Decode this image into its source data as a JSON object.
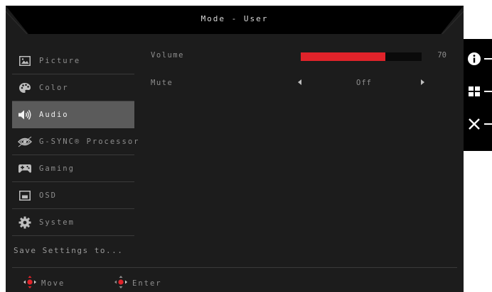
{
  "header": {
    "title": "Mode - User"
  },
  "menu": {
    "items": [
      {
        "label": "Picture",
        "icon": "picture-icon",
        "active": false
      },
      {
        "label": "Color",
        "icon": "palette-icon",
        "active": false
      },
      {
        "label": "Audio",
        "icon": "speaker-icon",
        "active": true
      },
      {
        "label": "G-SYNC® Processor",
        "icon": "gsync-eye-icon",
        "active": false
      },
      {
        "label": "Gaming",
        "icon": "gamepad-icon",
        "active": false
      },
      {
        "label": "OSD",
        "icon": "osd-icon",
        "active": false
      },
      {
        "label": "System",
        "icon": "gear-icon",
        "active": false
      }
    ],
    "save_label": "Save Settings to..."
  },
  "audio": {
    "volume": {
      "label": "Volume",
      "value": 70,
      "display": "70"
    },
    "mute": {
      "label": "Mute",
      "value": "Off"
    }
  },
  "footer": {
    "move_label": "Move",
    "enter_label": "Enter"
  },
  "side_buttons": [
    {
      "icon": "info-icon"
    },
    {
      "icon": "grid-icon"
    },
    {
      "icon": "close-icon"
    }
  ],
  "colors": {
    "accent": "#e0232a",
    "background": "#1c1c1c",
    "active_row": "#5b5b5b"
  }
}
